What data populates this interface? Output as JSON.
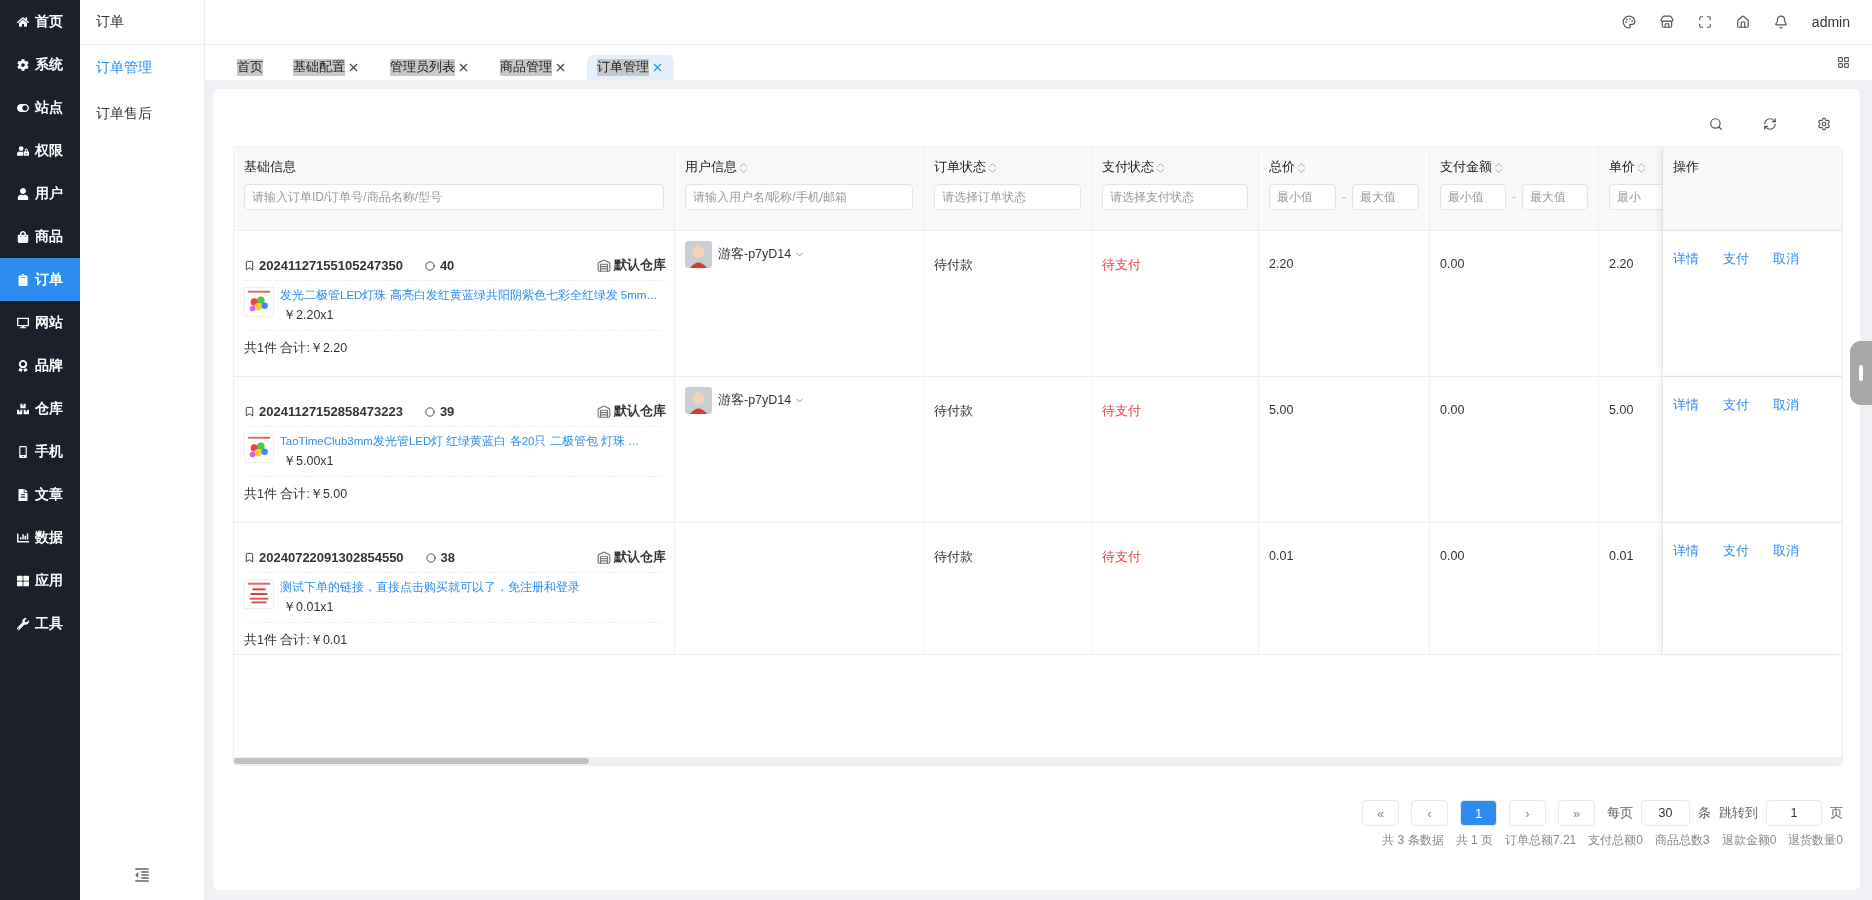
{
  "nav": [
    {
      "label": "首页",
      "selected": false
    },
    {
      "label": "系统",
      "selected": false
    },
    {
      "label": "站点",
      "selected": false
    },
    {
      "label": "权限",
      "selected": false
    },
    {
      "label": "用户",
      "selected": false
    },
    {
      "label": "商品",
      "selected": false
    },
    {
      "label": "订单",
      "selected": true
    },
    {
      "label": "网站",
      "selected": false
    },
    {
      "label": "品牌",
      "selected": false
    },
    {
      "label": "仓库",
      "selected": false
    },
    {
      "label": "手机",
      "selected": false
    },
    {
      "label": "文章",
      "selected": false
    },
    {
      "label": "数据",
      "selected": false
    },
    {
      "label": "应用",
      "selected": false
    },
    {
      "label": "工具",
      "selected": false
    }
  ],
  "submenu": {
    "title": "订单",
    "items": [
      {
        "label": "订单管理",
        "selected": true
      },
      {
        "label": "订单售后",
        "selected": false
      }
    ]
  },
  "header": {
    "user": "admin"
  },
  "tabs": [
    {
      "label": "首页",
      "closable": false,
      "selected": false
    },
    {
      "label": "基础配置",
      "closable": true,
      "selected": false
    },
    {
      "label": "管理员列表",
      "closable": true,
      "selected": false
    },
    {
      "label": "商品管理",
      "closable": true,
      "selected": false
    },
    {
      "label": "订单管理",
      "closable": true,
      "selected": true
    }
  ],
  "table": {
    "columns": [
      {
        "title": "基础信息",
        "sortable": false,
        "filter": {
          "kind": "text",
          "placeholder": "请输入订单ID/订单号/商品名称/型号"
        }
      },
      {
        "title": "用户信息",
        "sortable": true,
        "filter": {
          "kind": "text",
          "placeholder": "请输入用户名/昵称/手机/邮箱"
        }
      },
      {
        "title": "订单状态",
        "sortable": true,
        "filter": {
          "kind": "text",
          "placeholder": "请选择订单状态"
        }
      },
      {
        "title": "支付状态",
        "sortable": true,
        "filter": {
          "kind": "text",
          "placeholder": "请选择支付状态"
        }
      },
      {
        "title": "总价",
        "sortable": true,
        "filter": {
          "kind": "range",
          "fields": [
            {
              "placeholder": "最小值"
            },
            {
              "placeholder": "最大值"
            }
          ],
          "sep": "-"
        }
      },
      {
        "title": "支付金额",
        "sortable": true,
        "filter": {
          "kind": "range",
          "fields": [
            {
              "placeholder": "最小值"
            },
            {
              "placeholder": "最大值"
            }
          ],
          "sep": "-"
        }
      },
      {
        "title": "单价",
        "sortable": true,
        "filter": {
          "kind": "cut",
          "placeholder": "最小"
        }
      },
      {
        "title": "操作",
        "sortable": false,
        "filter": {
          "kind": "none"
        }
      }
    ],
    "rows": [
      {
        "order_no": "20241127155105247350",
        "count": "40",
        "warehouse": "默认仓库",
        "product": "发光二极管LED灯珠 高亮白发红黄蓝绿共阳阴紫色七彩全红绿发 5mm…",
        "price": "￥2.20x1",
        "summary": "共1件 合计:￥2.20",
        "user": "游客-p7yD14",
        "order_status": "待付款",
        "pay_status": "待支付",
        "total": "2.20",
        "paid": "0.00",
        "unit": "2.20",
        "actions": [
          "详情",
          "支付",
          "取消"
        ]
      },
      {
        "order_no": "20241127152858473223",
        "count": "39",
        "warehouse": "默认仓库",
        "product": "TaoTimeClub3mm发光管LED灯 红绿黄蓝白 各20只 二极管包 灯珠 …",
        "price": "￥5.00x1",
        "summary": "共1件 合计:￥5.00",
        "user": "游客-p7yD14",
        "order_status": "待付款",
        "pay_status": "待支付",
        "total": "5.00",
        "paid": "0.00",
        "unit": "5.00",
        "actions": [
          "详情",
          "支付",
          "取消"
        ]
      },
      {
        "order_no": "20240722091302854550",
        "count": "38",
        "warehouse": "默认仓库",
        "product": "测试下单的链接，直接点击购买就可以了，免注册和登录",
        "price": "￥0.01x1",
        "summary": "共1件 合计:￥0.01",
        "order_status": "待付款",
        "pay_status": "待支付",
        "total": "0.01",
        "paid": "0.00",
        "unit": "0.01",
        "actions": [
          "详情",
          "支付",
          "取消"
        ]
      }
    ]
  },
  "pagination": {
    "buttons": [
      {
        "label": "«",
        "selected": false
      },
      {
        "label": "‹",
        "selected": false
      },
      {
        "label": "1",
        "selected": true
      },
      {
        "label": "›",
        "selected": false
      },
      {
        "label": "»",
        "selected": false
      }
    ],
    "per_page_label": "每页",
    "per_page": "30",
    "per_page_unit": "条",
    "jump_label": "跳转到",
    "jump": "1",
    "jump_unit": "页",
    "stats": [
      "共 3 条数据",
      "共 1 页",
      "订单总额7.21",
      "支付总额0",
      "商品总数3",
      "退款金额0",
      "退货数量0"
    ]
  }
}
